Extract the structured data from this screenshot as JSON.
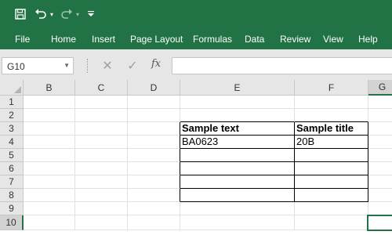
{
  "ribbon": {
    "accent_color": "#217346",
    "quick_access": [
      {
        "name": "save-icon",
        "glyph": "save"
      },
      {
        "name": "undo-icon",
        "glyph": "↶"
      },
      {
        "name": "undo-dropdown-icon",
        "glyph": "▾"
      },
      {
        "name": "redo-icon",
        "glyph": "↷"
      },
      {
        "name": "redo-dropdown-icon",
        "glyph": "▾"
      },
      {
        "name": "customize-qat-icon",
        "glyph": "▾"
      }
    ],
    "menu": [
      "File",
      "Home",
      "Insert",
      "Page Layout",
      "Formulas",
      "Data",
      "Review",
      "View",
      "Help"
    ]
  },
  "formula_bar": {
    "name_box": "G10",
    "cancel_icon": "✕",
    "enter_icon": "✓",
    "fx_label": "fx",
    "formula": ""
  },
  "grid": {
    "columns": [
      "B",
      "C",
      "D",
      "E",
      "F",
      "G"
    ],
    "rows": [
      "1",
      "2",
      "3",
      "4",
      "5",
      "6",
      "7",
      "8",
      "9",
      "10"
    ],
    "selected_cell": "G10",
    "table": {
      "headers": [
        "Sample text",
        "Sample title"
      ],
      "rows": [
        [
          "BA0623",
          "20B"
        ],
        [
          "",
          ""
        ],
        [
          "",
          ""
        ],
        [
          "",
          ""
        ],
        [
          "",
          ""
        ]
      ]
    }
  }
}
